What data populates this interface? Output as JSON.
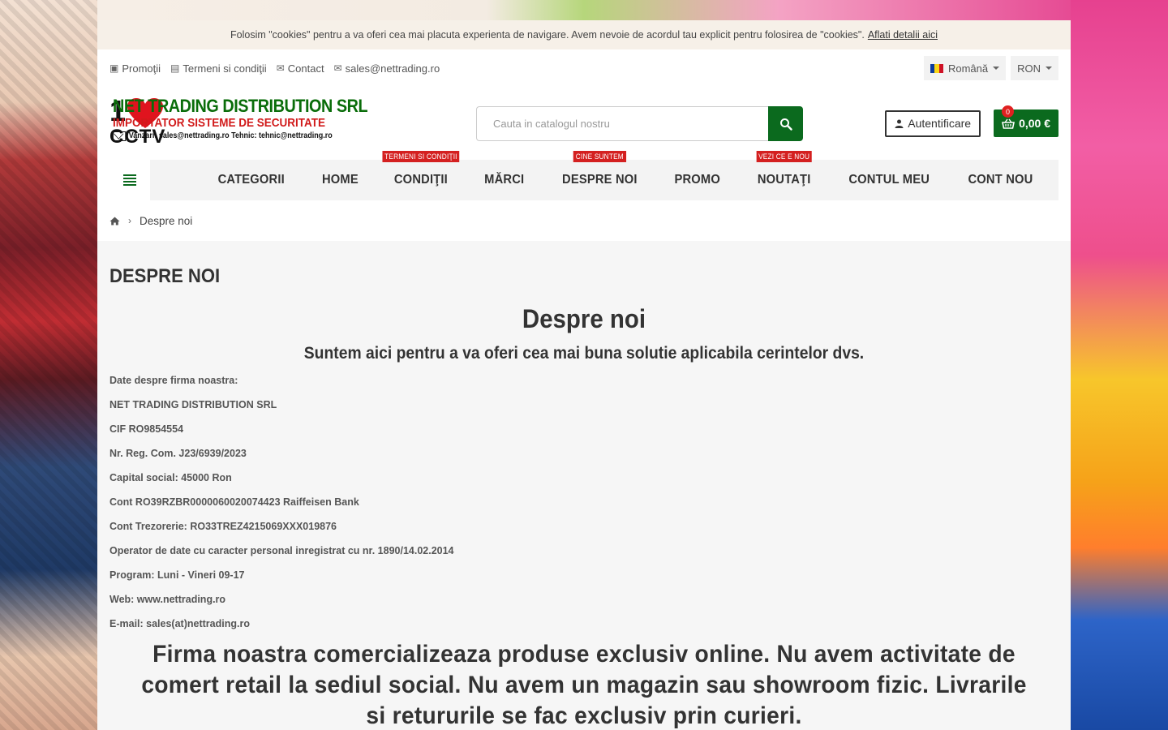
{
  "cookie": {
    "text": "Folosim \"cookies\" pentru a va oferi cea mai placuta experienta de navigare. Avem nevoie de acordul tau explicit pentru folosirea de \"cookies\".",
    "link": "Aflati detalii aici"
  },
  "topbar": {
    "links": [
      "Promoţii",
      "Termeni si condiţii",
      "Contact",
      "sales@nettrading.ro"
    ],
    "language": "Română",
    "currency": "RON"
  },
  "logo": {
    "one": "1",
    "cctv": "CCTV",
    "name": "NET TRADING DISTRIBUTION SRL",
    "sub": "IMPORTATOR SISTEME DE SECURITATE",
    "contact": "Vanzari: sales@nettrading.ro  Tehnic: tehnic@nettrading.ro"
  },
  "search": {
    "placeholder": "Cauta in catalogul nostru"
  },
  "user": {
    "login": "Autentificare",
    "cart_total": "0,00 €",
    "cart_count": "0"
  },
  "nav": {
    "items": [
      {
        "label": "CATEGORII",
        "badge": ""
      },
      {
        "label": "HOME",
        "badge": ""
      },
      {
        "label": "CONDIŢII",
        "badge": "TERMENI SI CONDIŢII"
      },
      {
        "label": "MĂRCI",
        "badge": ""
      },
      {
        "label": "DESPRE NOI",
        "badge": "CINE SUNTEM"
      },
      {
        "label": "PROMO",
        "badge": ""
      },
      {
        "label": "NOUTAŢI",
        "badge": "VEZI CE E NOU"
      },
      {
        "label": "CONTUL MEU",
        "badge": ""
      },
      {
        "label": "CONT NOU",
        "badge": ""
      }
    ]
  },
  "breadcrumb": {
    "current": "Despre noi"
  },
  "main": {
    "page_title": "DESPRE NOI",
    "heading": "Despre noi",
    "subheading": "Suntem aici pentru a va oferi cea mai buna solutie aplicabila cerintelor dvs.",
    "info": [
      "Date despre firma noastra:",
      "NET TRADING DISTRIBUTION SRL",
      "CIF RO9854554",
      "Nr. Reg. Com. J23/6939/2023",
      "Capital social: 45000 Ron",
      "Cont RO39RZBR0000060020074423 Raiffeisen Bank",
      "Cont Trezorerie: RO33TREZ4215069XXX019876",
      "Operator de date cu caracter personal inregistrat cu nr. 1890/14.02.2014",
      "Program: Luni - Vineri 09-17",
      "Web: www.nettrading.ro",
      "E-mail: sales(at)nettrading.ro"
    ],
    "notice": "Firma noastra comercializeaza produse exclusiv online. Nu avem activitate de comert retail la sediul social. Nu avem un magazin sau showroom fizic. Livrarile si retururile se fac exclusiv prin curieri."
  },
  "colors": {
    "brand_green": "#0b6a1e",
    "badge_red": "#d42020",
    "logo_red": "#d11a1a"
  }
}
